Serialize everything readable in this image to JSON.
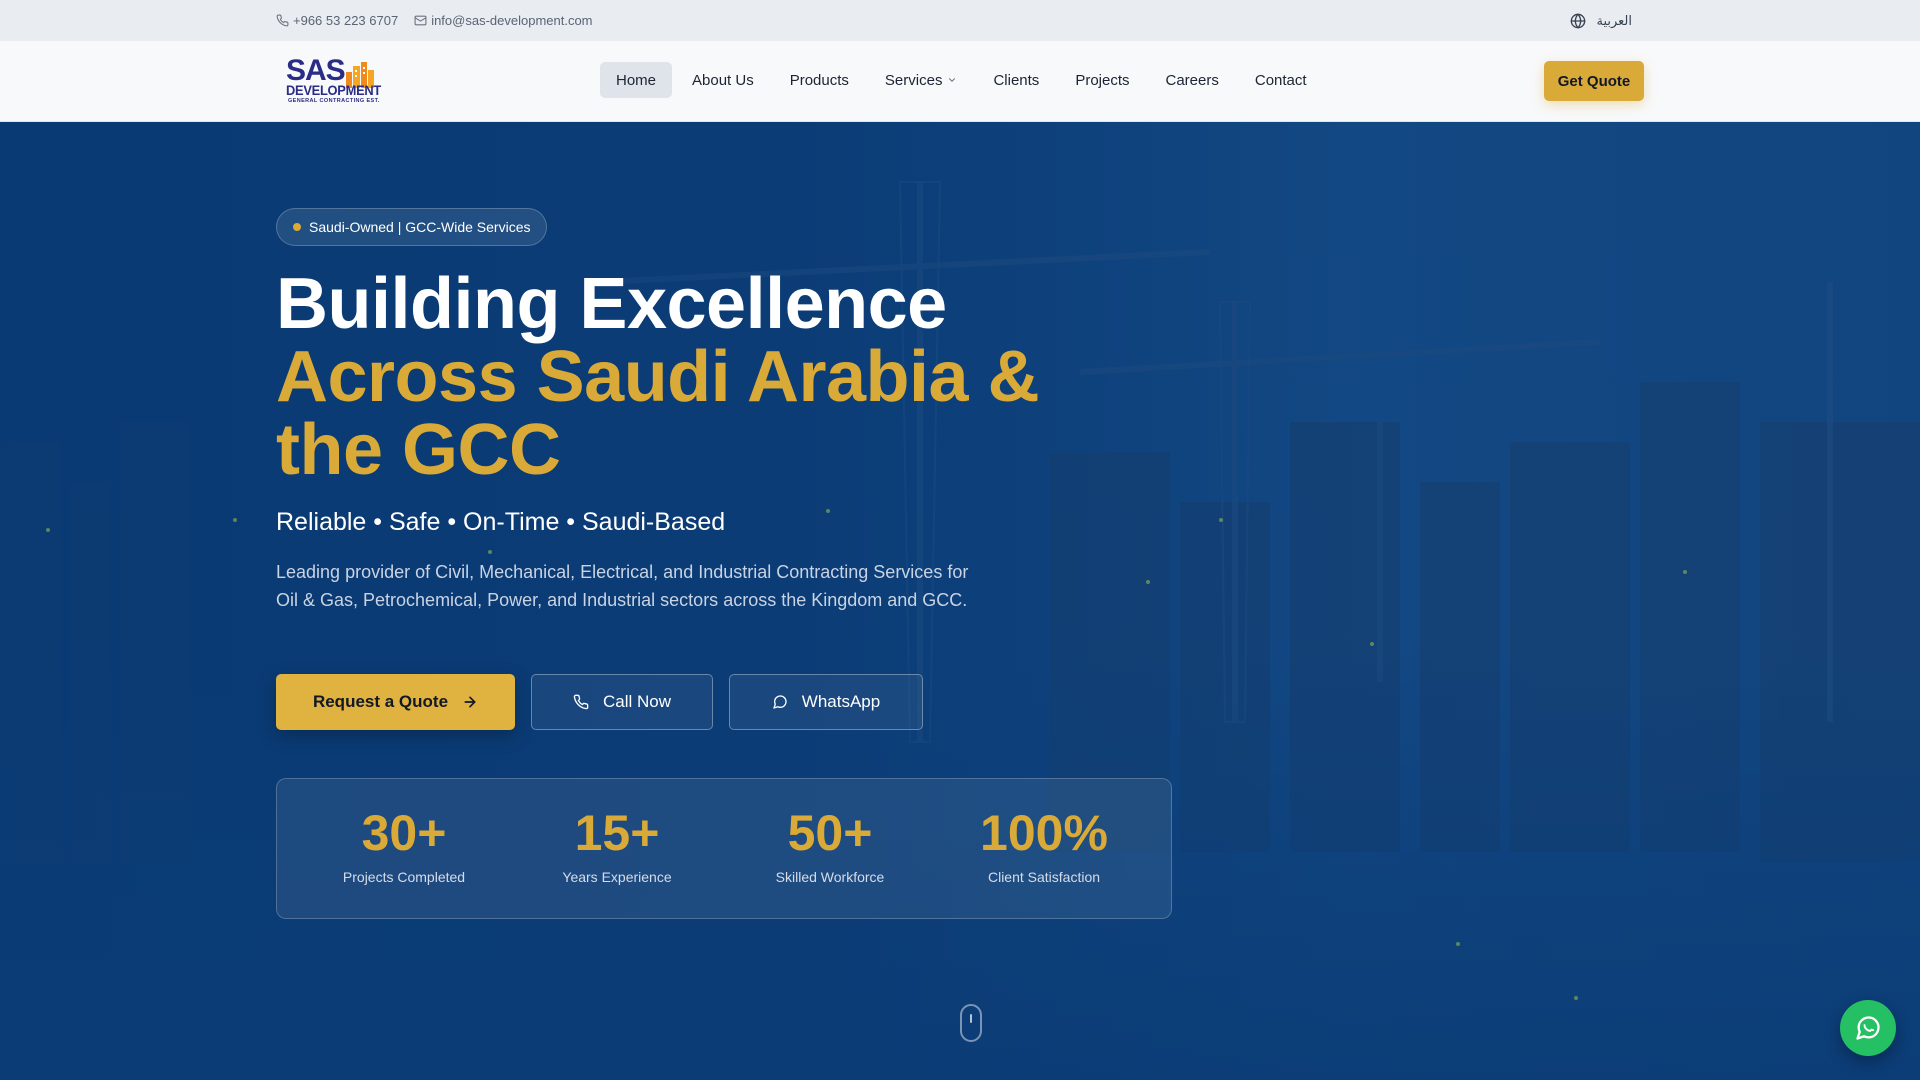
{
  "topbar": {
    "phone": "+966 53 223 6707",
    "email": "info@sas-development.com",
    "language": "العربية"
  },
  "logo": {
    "line1": "SAS",
    "line2": "DEVELOPMENT",
    "line3": "GENERAL CONTRACTING EST."
  },
  "nav": {
    "items": [
      {
        "label": "Home",
        "active": true
      },
      {
        "label": "About Us"
      },
      {
        "label": "Products"
      },
      {
        "label": "Services",
        "has_dropdown": true
      },
      {
        "label": "Clients"
      },
      {
        "label": "Projects"
      },
      {
        "label": "Careers"
      },
      {
        "label": "Contact"
      }
    ],
    "cta": "Get Quote"
  },
  "hero": {
    "badge": "Saudi-Owned | GCC-Wide Services",
    "headline_line1": "Building Excellence",
    "headline_line2": "Across Saudi Arabia &",
    "headline_line3": "the GCC",
    "tagline": "Reliable • Safe • On-Time • Saudi-Based",
    "description": "Leading provider of Civil, Mechanical, Electrical, and Industrial Contracting Services for Oil & Gas, Petrochemical, Power, and Industrial sectors across the Kingdom and GCC.",
    "buttons": {
      "request_quote": "Request a Quote",
      "call_now": "Call Now",
      "whatsapp": "WhatsApp"
    },
    "stats": [
      {
        "value": "30+",
        "label": "Projects Completed"
      },
      {
        "value": "15+",
        "label": "Years Experience"
      },
      {
        "value": "50+",
        "label": "Skilled Workforce"
      },
      {
        "value": "100%",
        "label": "Client Satisfaction"
      }
    ]
  },
  "colors": {
    "accent": "#d9aa37",
    "hero_bg": "#0b3c76",
    "whatsapp_green": "#25c063"
  }
}
